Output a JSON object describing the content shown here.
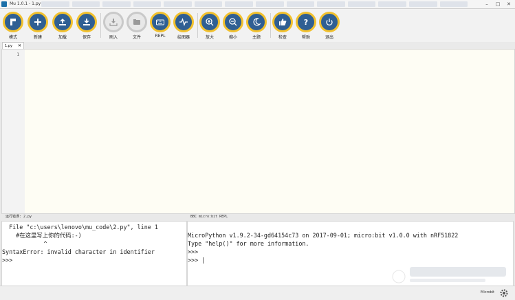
{
  "window": {
    "title": "Mu 1.0.1 - 1.py"
  },
  "toolbar": {
    "mode": "模式",
    "new": "新建",
    "load": "加载",
    "save": "保存",
    "flash": "刷入",
    "files": "文件",
    "repl": "REPL",
    "plotter": "绘图器",
    "zoom_in": "放大",
    "zoom_out": "缩小",
    "theme": "主题",
    "check": "检查",
    "help": "帮助",
    "quit": "退出"
  },
  "tabs": [
    {
      "label": "1.py",
      "close": "✕"
    }
  ],
  "editor": {
    "line_numbers": [
      "1"
    ]
  },
  "panels": {
    "left_header": "运行错误: 2.py",
    "right_header": "BBC micro:bit REPL",
    "left_lines": [
      "  File \"c:\\users\\lenovo\\mu_code\\2.py\", line 1",
      "    #在这里写上你的代码:-)",
      "            ^",
      "SyntaxError: invalid character in identifier",
      ">>>"
    ],
    "right_lines": [
      "MicroPython v1.9.2-34-gd64154c73 on 2017-09-01; micro:bit v1.0.0 with nRF51822",
      "Type \"help()\" for more information.",
      ">>>",
      ">>> |"
    ]
  },
  "status": {
    "mode": "Microbit"
  }
}
